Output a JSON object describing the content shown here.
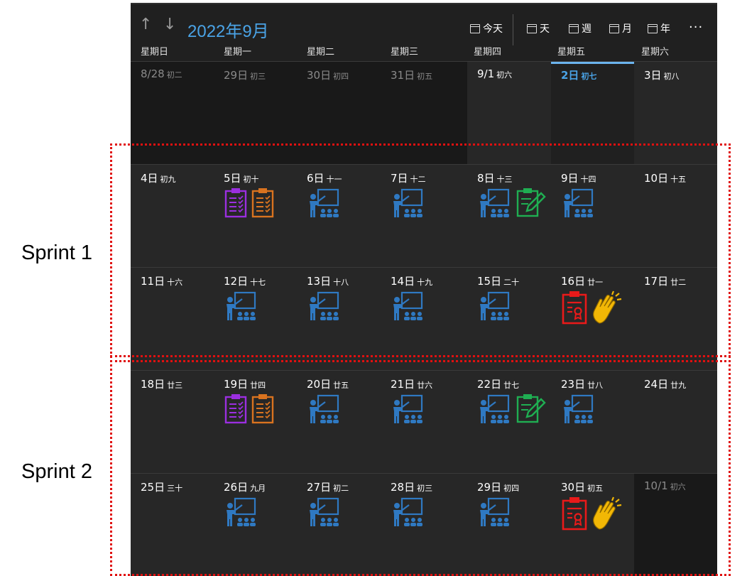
{
  "sprints": [
    {
      "label": "Sprint 1"
    },
    {
      "label": "Sprint 2"
    }
  ],
  "toolbar": {
    "up_icon": "arrow-up-icon",
    "down_icon": "arrow-down-icon",
    "month_title": "2022年9月",
    "today_label": "今天",
    "day_label": "天",
    "week_label": "週",
    "month_label": "月",
    "year_label": "年",
    "more_label": "···"
  },
  "weekdays": [
    "星期日",
    "星期一",
    "星期二",
    "星期三",
    "星期四",
    "星期五",
    "星期六"
  ],
  "colors": {
    "accent": "#4aa3e6",
    "background": "#202020",
    "training": "#2f79c2",
    "checklist_purple": "#9b2fe0",
    "checklist_orange": "#d9731f",
    "edit_green": "#1fae52",
    "certificate_red": "#e81a1a",
    "clap_yellow": "#f2b705",
    "sprint_border": "#e01010"
  },
  "weeks": [
    {
      "days": [
        {
          "day": "8/28",
          "lunar": "初二",
          "state": "dim",
          "icons": []
        },
        {
          "day": "29日",
          "lunar": "初三",
          "state": "dim",
          "icons": []
        },
        {
          "day": "30日",
          "lunar": "初四",
          "state": "dim",
          "icons": []
        },
        {
          "day": "31日",
          "lunar": "初五",
          "state": "dim",
          "icons": []
        },
        {
          "day": "9/1",
          "lunar": "初六",
          "state": "cur",
          "icons": []
        },
        {
          "day": "2日",
          "lunar": "初七",
          "state": "today",
          "icons": []
        },
        {
          "day": "3日",
          "lunar": "初八",
          "state": "cur",
          "icons": []
        }
      ]
    },
    {
      "days": [
        {
          "day": "4日",
          "lunar": "初九",
          "state": "cur",
          "icons": []
        },
        {
          "day": "5日",
          "lunar": "初十",
          "state": "cur",
          "icons": [
            "checklist-purple-icon",
            "checklist-orange-icon"
          ]
        },
        {
          "day": "6日",
          "lunar": "十一",
          "state": "cur",
          "icons": [
            "training-icon"
          ]
        },
        {
          "day": "7日",
          "lunar": "十二",
          "state": "cur",
          "icons": [
            "training-icon"
          ]
        },
        {
          "day": "8日",
          "lunar": "十三",
          "state": "cur",
          "icons": [
            "training-icon",
            "clipboard-edit-icon"
          ]
        },
        {
          "day": "9日",
          "lunar": "十四",
          "state": "cur",
          "icons": [
            "training-icon"
          ]
        },
        {
          "day": "10日",
          "lunar": "十五",
          "state": "cur",
          "icons": []
        }
      ]
    },
    {
      "days": [
        {
          "day": "11日",
          "lunar": "十六",
          "state": "cur",
          "icons": []
        },
        {
          "day": "12日",
          "lunar": "十七",
          "state": "cur",
          "icons": [
            "training-icon"
          ]
        },
        {
          "day": "13日",
          "lunar": "十八",
          "state": "cur",
          "icons": [
            "training-icon"
          ]
        },
        {
          "day": "14日",
          "lunar": "十九",
          "state": "cur",
          "icons": [
            "training-icon"
          ]
        },
        {
          "day": "15日",
          "lunar": "二十",
          "state": "cur",
          "icons": [
            "training-icon"
          ]
        },
        {
          "day": "16日",
          "lunar": "廿一",
          "state": "cur",
          "icons": [
            "certificate-icon",
            "clapping-hands-icon"
          ]
        },
        {
          "day": "17日",
          "lunar": "廿二",
          "state": "cur",
          "icons": []
        }
      ]
    },
    {
      "days": [
        {
          "day": "18日",
          "lunar": "廿三",
          "state": "cur",
          "icons": []
        },
        {
          "day": "19日",
          "lunar": "廿四",
          "state": "cur",
          "icons": [
            "checklist-purple-icon",
            "checklist-orange-icon"
          ]
        },
        {
          "day": "20日",
          "lunar": "廿五",
          "state": "cur",
          "icons": [
            "training-icon"
          ]
        },
        {
          "day": "21日",
          "lunar": "廿六",
          "state": "cur",
          "icons": [
            "training-icon"
          ]
        },
        {
          "day": "22日",
          "lunar": "廿七",
          "state": "cur",
          "icons": [
            "training-icon",
            "clipboard-edit-icon"
          ]
        },
        {
          "day": "23日",
          "lunar": "廿八",
          "state": "cur",
          "icons": [
            "training-icon"
          ]
        },
        {
          "day": "24日",
          "lunar": "廿九",
          "state": "cur",
          "icons": []
        }
      ]
    },
    {
      "days": [
        {
          "day": "25日",
          "lunar": "三十",
          "state": "cur",
          "icons": []
        },
        {
          "day": "26日",
          "lunar": "九月",
          "state": "cur",
          "icons": [
            "training-icon"
          ]
        },
        {
          "day": "27日",
          "lunar": "初二",
          "state": "cur",
          "icons": [
            "training-icon"
          ]
        },
        {
          "day": "28日",
          "lunar": "初三",
          "state": "cur",
          "icons": [
            "training-icon"
          ]
        },
        {
          "day": "29日",
          "lunar": "初四",
          "state": "cur",
          "icons": [
            "training-icon"
          ]
        },
        {
          "day": "30日",
          "lunar": "初五",
          "state": "cur",
          "icons": [
            "certificate-icon",
            "clapping-hands-icon"
          ]
        },
        {
          "day": "10/1",
          "lunar": "初六",
          "state": "dim",
          "icons": []
        }
      ]
    }
  ]
}
